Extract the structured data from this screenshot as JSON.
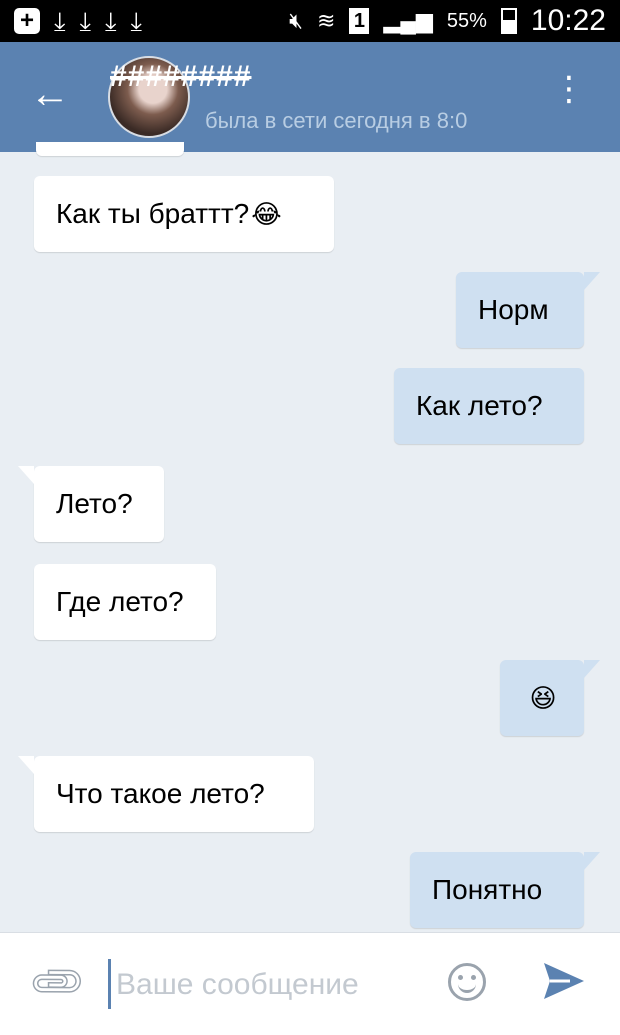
{
  "status_bar": {
    "battery": "55%",
    "time": "10:22",
    "sim": "1"
  },
  "header": {
    "contact_name": "########",
    "last_seen": "была в сети сегодня в 8:0"
  },
  "messages": [
    {
      "direction": "incoming",
      "text": "Как ты браттт?",
      "emoji": "😂"
    },
    {
      "direction": "outgoing",
      "text": "Норм"
    },
    {
      "direction": "outgoing",
      "text": "Как лето?"
    },
    {
      "direction": "incoming",
      "text": "Лето?"
    },
    {
      "direction": "incoming",
      "text": "Где лето?"
    },
    {
      "direction": "outgoing",
      "text": "",
      "emoji": "😆"
    },
    {
      "direction": "incoming",
      "text": "Что такое лето?"
    },
    {
      "direction": "outgoing",
      "text": "Понятно"
    }
  ],
  "composer": {
    "placeholder": "Ваше сообщение"
  },
  "colors": {
    "header": "#5b82b1",
    "background": "#e9eef3",
    "incoming_bubble": "#ffffff",
    "outgoing_bubble": "#cfe0f1"
  }
}
